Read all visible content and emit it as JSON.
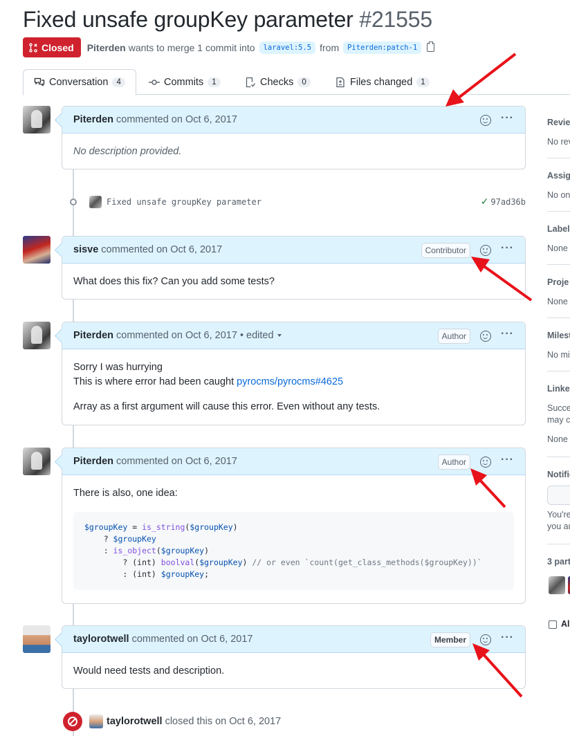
{
  "pr": {
    "title": "Fixed unsafe groupKey parameter",
    "number": "#21555",
    "state": "Closed",
    "author": "Piterden",
    "merge_text": "wants to merge 1 commit into",
    "base_branch": "laravel:5.5",
    "from_text": "from",
    "head_branch": "Piterden:patch-1"
  },
  "tabs": [
    {
      "label": "Conversation",
      "count": "4",
      "icon": "comment-discussion-icon"
    },
    {
      "label": "Commits",
      "count": "1",
      "icon": "git-commit-icon"
    },
    {
      "label": "Checks",
      "count": "0",
      "icon": "checklist-icon"
    },
    {
      "label": "Files changed",
      "count": "1",
      "icon": "file-diff-icon"
    }
  ],
  "comments": [
    {
      "author": "Piterden",
      "meta": "commented on Oct 6, 2017",
      "body": "No description provided."
    },
    {
      "author": "sisve",
      "meta": "commented on Oct 6, 2017",
      "role": "Contributor",
      "body": "What does this fix? Can you add some tests?"
    },
    {
      "author": "Piterden",
      "meta": "commented on Oct 6, 2017 • edited",
      "role": "Author",
      "line1": "Sorry I was hurrying",
      "line2_prefix": "This is where error had been caught ",
      "link": "pyrocms/pyrocms#4625",
      "line3": "Array as a first argument will cause this error. Even without any tests."
    },
    {
      "author": "Piterden",
      "meta": "commented on Oct 6, 2017",
      "role": "Author",
      "body": "There is also, one idea:"
    },
    {
      "author": "taylorotwell",
      "meta": "commented on Oct 6, 2017",
      "role": "Member",
      "body": "Would need tests and description."
    }
  ],
  "commit": {
    "message": "Fixed unsafe groupKey parameter",
    "sha": "97ad36b"
  },
  "closed_event": {
    "actor": "taylorotwell",
    "text": "closed this on Oct 6, 2017"
  },
  "sidebar": {
    "reviewers": {
      "heading": "Revie",
      "value": "No rev"
    },
    "assignees": {
      "heading": "Assig",
      "value": "No on"
    },
    "labels": {
      "heading": "Label",
      "value": "None"
    },
    "projects": {
      "heading": "Proje",
      "value": "None"
    },
    "milestone": {
      "heading": "Milest",
      "value": "No mi"
    },
    "linked": {
      "heading": "Linke",
      "value1": "Succe",
      "value2": "may c",
      "value3": "None"
    },
    "notifications": {
      "heading": "Notific",
      "value1": "You're",
      "value2": "you au"
    },
    "participants": {
      "heading": "3 part"
    },
    "allow": {
      "label": "Al"
    }
  },
  "colors": {
    "closed_red": "#cf222e",
    "header_blue": "#ddf4ff",
    "link_blue": "#0969da",
    "arrow_red": "#e8121a"
  }
}
